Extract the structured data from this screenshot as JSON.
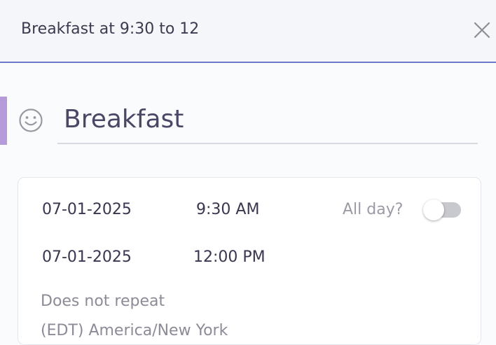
{
  "header": {
    "title": "Breakfast at 9:30 to 12",
    "close_icon": "close-icon"
  },
  "event": {
    "emoji_icon": "smiley-icon",
    "title": "Breakfast",
    "accent_color": "#b59bd9"
  },
  "schedule": {
    "start_date": "07-01-2025",
    "start_time": "9:30 AM",
    "end_date": "07-01-2025",
    "end_time": "12:00 PM",
    "all_day_label": "All day?",
    "all_day": false,
    "repeat": "Does not repeat",
    "timezone": "(EDT) America/New York"
  }
}
